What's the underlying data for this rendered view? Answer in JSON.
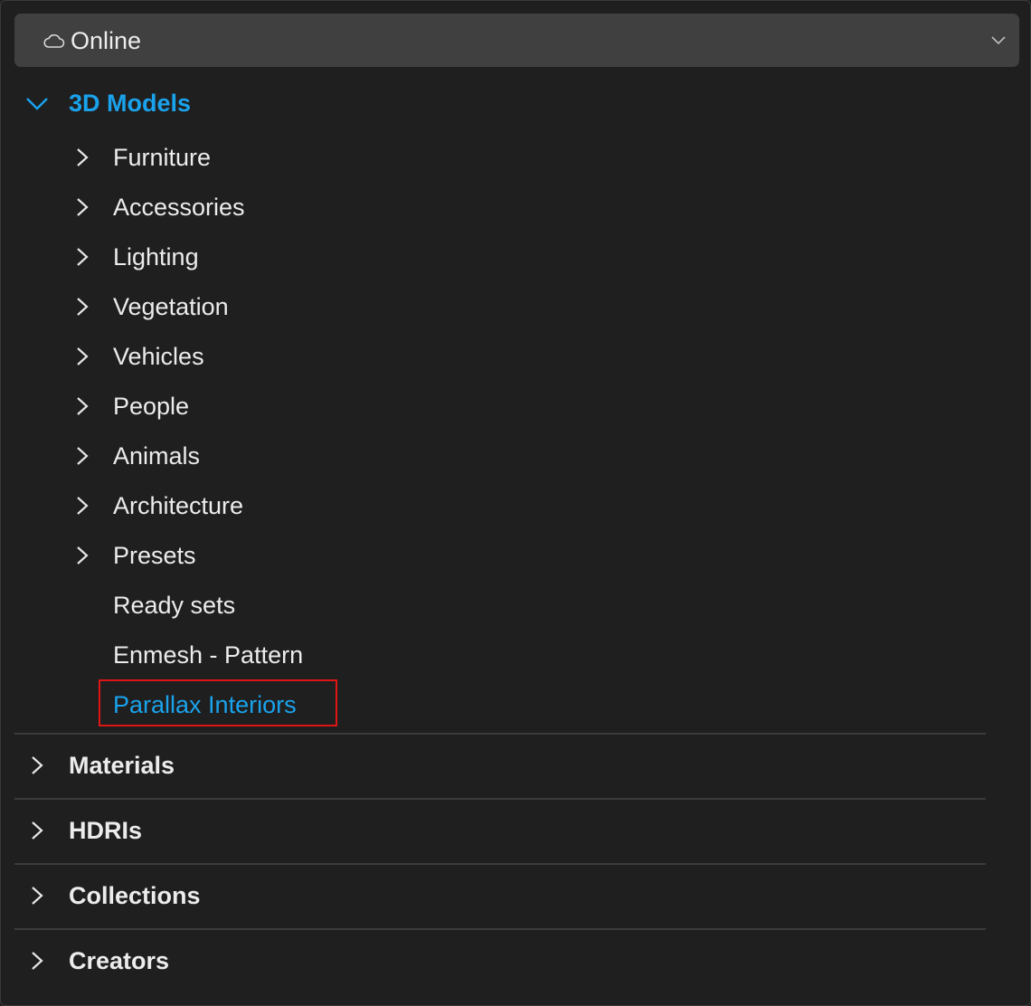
{
  "source_selector": {
    "icon": "cloud-icon",
    "value": "Online",
    "toggle_icon": "chevron-down-icon"
  },
  "tree": {
    "root": {
      "label": "3D Models",
      "expanded": true,
      "color": "#1aa3ec"
    },
    "children": [
      {
        "label": "Furniture",
        "expandable": true
      },
      {
        "label": "Accessories",
        "expandable": true
      },
      {
        "label": "Lighting",
        "expandable": true
      },
      {
        "label": "Vegetation",
        "expandable": true
      },
      {
        "label": "Vehicles",
        "expandable": true
      },
      {
        "label": "People",
        "expandable": true
      },
      {
        "label": "Animals",
        "expandable": true
      },
      {
        "label": "Architecture",
        "expandable": true
      },
      {
        "label": "Presets",
        "expandable": true
      },
      {
        "label": "Ready sets",
        "expandable": false
      },
      {
        "label": "Enmesh - Pattern",
        "expandable": false
      },
      {
        "label": "Parallax Interiors",
        "expandable": false,
        "selected": true
      }
    ],
    "sections": [
      {
        "label": "Materials"
      },
      {
        "label": "HDRIs"
      },
      {
        "label": "Collections"
      },
      {
        "label": "Creators"
      }
    ]
  },
  "colors": {
    "accent": "#1aa3ec",
    "highlight_box": "#e01515",
    "background": "#1f1f1f"
  }
}
